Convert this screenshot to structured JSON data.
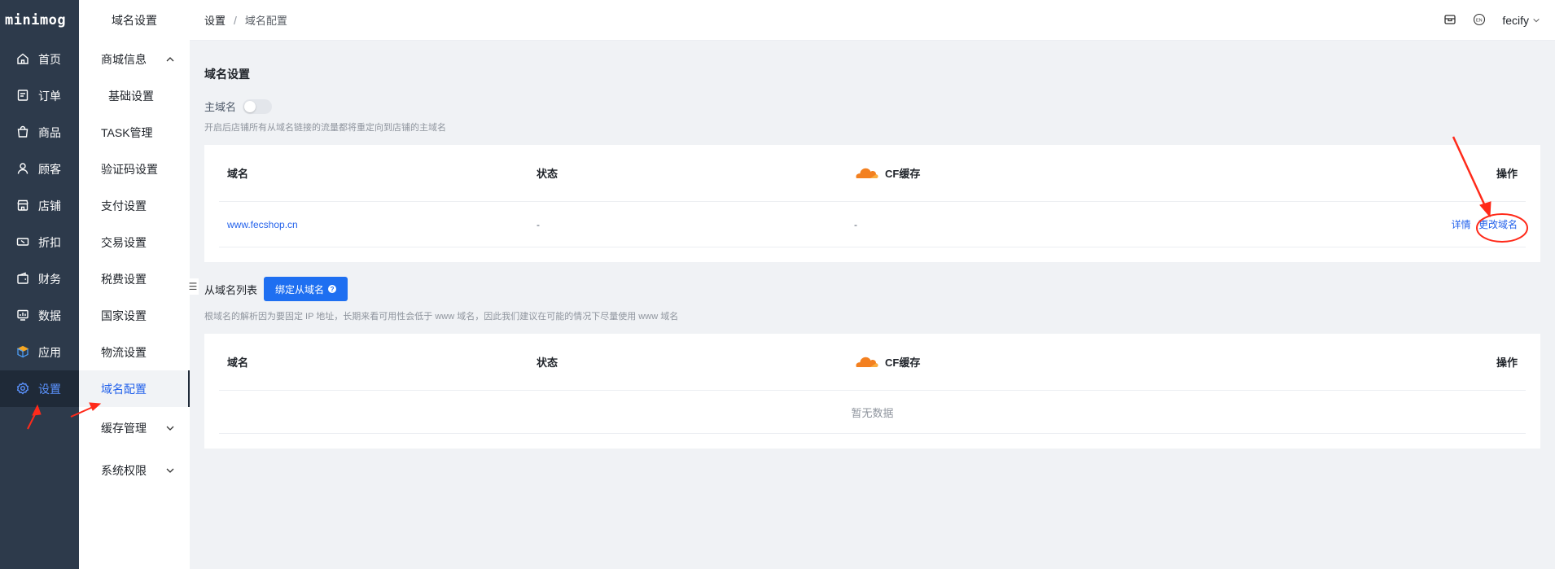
{
  "brand": "minimog",
  "nav": [
    {
      "label": "首页",
      "icon": "home-icon"
    },
    {
      "label": "订单",
      "icon": "order-icon"
    },
    {
      "label": "商品",
      "icon": "bag-icon"
    },
    {
      "label": "顾客",
      "icon": "user-icon"
    },
    {
      "label": "店铺",
      "icon": "store-icon"
    },
    {
      "label": "折扣",
      "icon": "ticket-icon"
    },
    {
      "label": "财务",
      "icon": "wallet-icon"
    },
    {
      "label": "数据",
      "icon": "chart-icon"
    },
    {
      "label": "应用",
      "icon": "cube-icon"
    },
    {
      "label": "设置",
      "icon": "gear-icon"
    }
  ],
  "subnav": {
    "title": "域名设置",
    "items": [
      {
        "label": "商城信息"
      },
      {
        "label": "基础设置"
      },
      {
        "label": "TASK管理"
      },
      {
        "label": "验证码设置"
      },
      {
        "label": "支付设置"
      },
      {
        "label": "交易设置"
      },
      {
        "label": "税费设置"
      },
      {
        "label": "国家设置"
      },
      {
        "label": "物流设置"
      },
      {
        "label": "域名配置"
      },
      {
        "label": "缓存管理"
      },
      {
        "label": "系统权限"
      }
    ]
  },
  "header": {
    "crumb_root": "设置",
    "crumb_sep": "/",
    "crumb_current": "域名配置",
    "user": "fecify"
  },
  "main": {
    "title": "域名设置",
    "primary_label": "主域名",
    "primary_enabled": false,
    "primary_hint": "开启后店铺所有从域名链接的流量都将重定向到店铺的主域名",
    "columns": {
      "domain": "域名",
      "status": "状态",
      "cf": "CF缓存",
      "actions": "操作"
    },
    "row": {
      "domain": "www.fecshop.cn",
      "status": "-",
      "cf": "-",
      "detail": "详情",
      "change": "更改域名"
    },
    "sub_title": "从域名列表",
    "bind_button": "绑定从域名",
    "bind_help": "?",
    "sub_hint": "根域名的解析因为要固定 IP 地址，长期来看可用性会低于 www 域名，因此我们建议在可能的情况下尽量使用 www 域名",
    "empty": "暂无数据"
  },
  "colors": {
    "accent": "#1e6ff1",
    "sidebar": "#2d3a4b",
    "cloud": "#f38020",
    "annotation": "#ff2a1a"
  }
}
